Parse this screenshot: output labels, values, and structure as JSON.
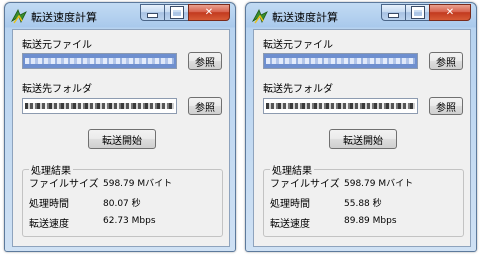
{
  "windows": [
    {
      "title": "転送速度計算",
      "source_label": "転送元ファイル",
      "dest_label": "転送先フォルダ",
      "browse_label": "参照",
      "start_label": "転送開始",
      "result_title": "処理結果",
      "results": [
        {
          "label": "ファイルサイズ",
          "value": "598.79 Mバイト"
        },
        {
          "label": "処理時間",
          "value": "80.07 秒"
        },
        {
          "label": "転送速度",
          "value": "62.73 Mbps"
        }
      ]
    },
    {
      "title": "転送速度計算",
      "source_label": "転送元ファイル",
      "dest_label": "転送先フォルダ",
      "browse_label": "参照",
      "start_label": "転送開始",
      "result_title": "処理結果",
      "results": [
        {
          "label": "ファイルサイズ",
          "value": "598.79 Mバイト"
        },
        {
          "label": "処理時間",
          "value": "55.88 秒"
        },
        {
          "label": "転送速度",
          "value": "89.89 Mbps"
        }
      ]
    }
  ],
  "icons": {
    "app": "app-icon",
    "minimize": "minimize-icon",
    "maximize": "maximize-icon",
    "close": "close-icon"
  }
}
